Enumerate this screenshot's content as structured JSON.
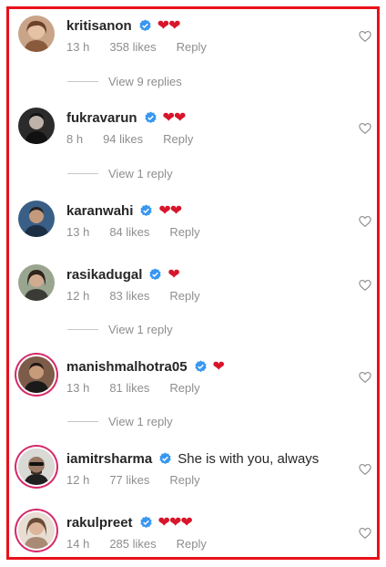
{
  "colors": {
    "frame": "#e8101a",
    "heart": "#d8152a",
    "verified": "#3897f0",
    "muted": "#8e8e8e"
  },
  "comments": [
    {
      "username": "kritisanon",
      "verified": true,
      "text": "",
      "hearts": "❤❤",
      "time": "13 h",
      "likes": "358 likes",
      "reply": "Reply",
      "view_replies": "View 9 replies",
      "ring": false
    },
    {
      "username": "fukravarun",
      "verified": true,
      "text": "",
      "hearts": "❤❤",
      "time": "8 h",
      "likes": "94 likes",
      "reply": "Reply",
      "view_replies": "View 1 reply",
      "ring": false
    },
    {
      "username": "karanwahi",
      "verified": true,
      "text": "",
      "hearts": "❤❤",
      "time": "13 h",
      "likes": "84 likes",
      "reply": "Reply",
      "view_replies": "",
      "ring": false
    },
    {
      "username": "rasikadugal",
      "verified": true,
      "text": "",
      "hearts": "❤",
      "time": "12 h",
      "likes": "83 likes",
      "reply": "Reply",
      "view_replies": "View 1 reply",
      "ring": false
    },
    {
      "username": "manishmalhotra05",
      "verified": true,
      "text": "",
      "hearts": "❤",
      "time": "13 h",
      "likes": "81 likes",
      "reply": "Reply",
      "view_replies": "View 1 reply",
      "ring": true
    },
    {
      "username": "iamitrsharma",
      "verified": true,
      "text": "She is with you, always",
      "hearts": "",
      "time": "12 h",
      "likes": "77 likes",
      "reply": "Reply",
      "view_replies": "",
      "ring": true
    },
    {
      "username": "rakulpreet",
      "verified": true,
      "text": "",
      "hearts": "❤❤❤",
      "time": "14 h",
      "likes": "285 likes",
      "reply": "Reply",
      "view_replies": "",
      "ring": true
    }
  ],
  "icons": {
    "verified": "verified-badge-icon",
    "like": "heart-outline-icon",
    "avatar": "avatar-photo"
  }
}
